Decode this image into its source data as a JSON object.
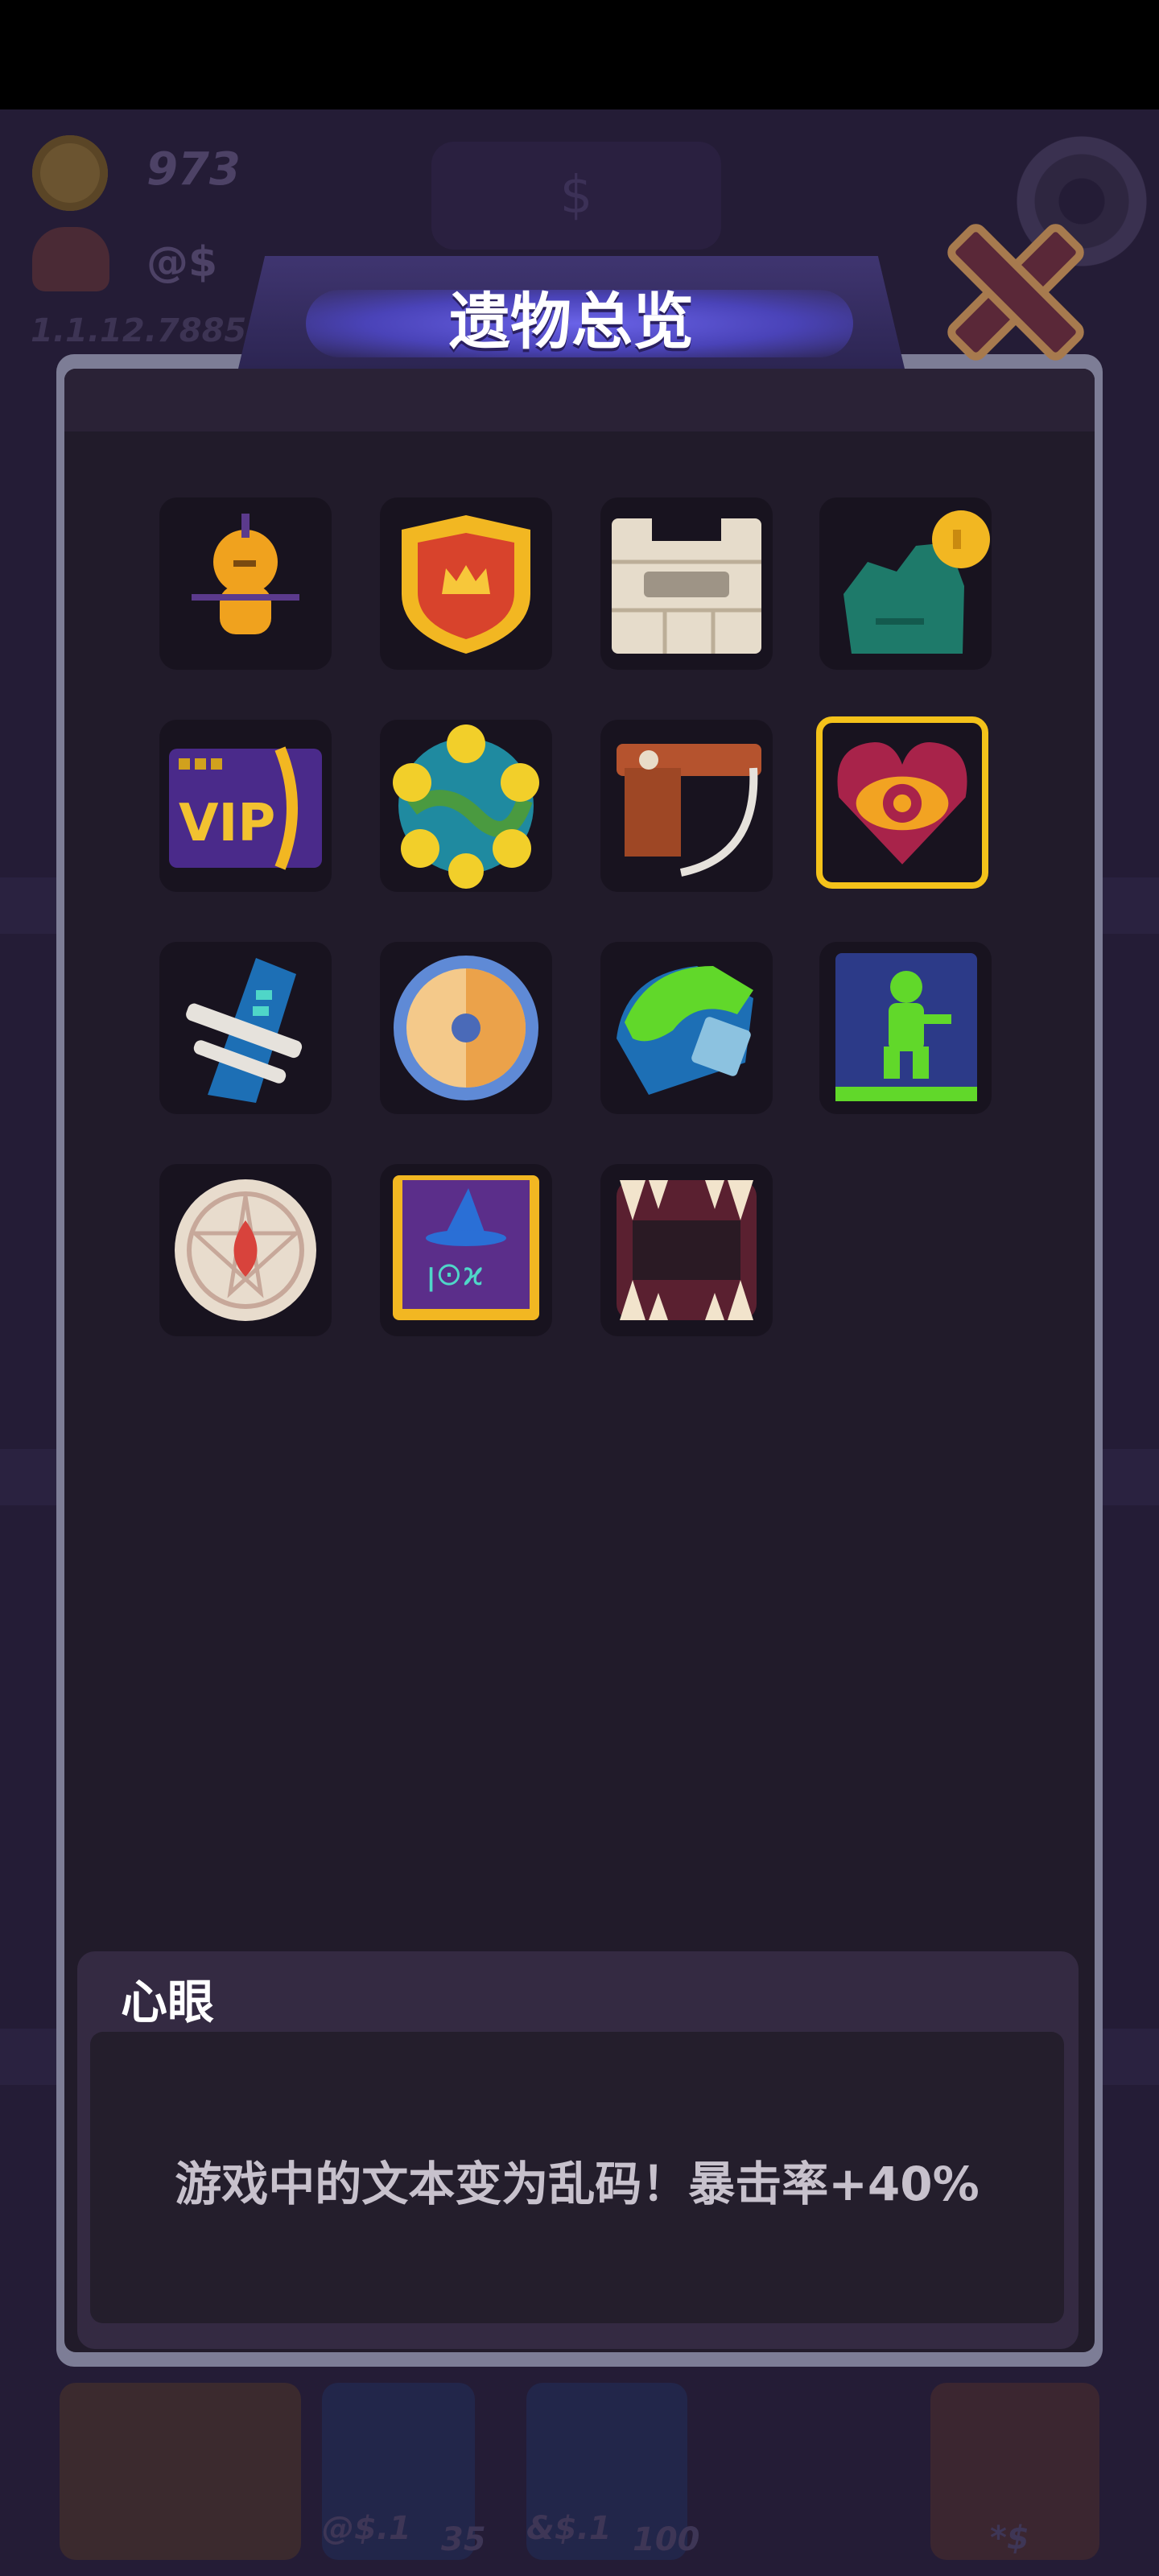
{
  "hud": {
    "coins": "973",
    "store_label": "$",
    "username": "@$",
    "version": "1.1.12.7885-"
  },
  "dialog": {
    "title": "遗物总览",
    "close_icon": "close-x-icon"
  },
  "relics": [
    {
      "icon": "spartan-helmet-figure-icon",
      "selected": false
    },
    {
      "icon": "crown-shield-icon",
      "selected": false
    },
    {
      "icon": "stone-castle-wall-icon",
      "selected": false
    },
    {
      "icon": "zombie-hand-coin-icon",
      "selected": false
    },
    {
      "icon": "vip-card-icon",
      "selected": false
    },
    {
      "icon": "spiked-planet-icon",
      "selected": false
    },
    {
      "icon": "wooden-scythe-icon",
      "selected": false
    },
    {
      "icon": "heart-eye-icon",
      "selected": true
    },
    {
      "icon": "blue-sword-hilt-icon",
      "selected": false
    },
    {
      "icon": "wooden-round-shield-icon",
      "selected": false
    },
    {
      "icon": "slime-fist-icon",
      "selected": false
    },
    {
      "icon": "soldier-book-icon",
      "selected": false
    },
    {
      "icon": "pentagram-drop-icon",
      "selected": false
    },
    {
      "icon": "wizard-spellbook-icon",
      "selected": false
    },
    {
      "icon": "fanged-mouth-icon",
      "selected": false
    }
  ],
  "description": {
    "name": "心眼",
    "text": "游戏中的文本变为乱码！暴击率+40%"
  },
  "bottom_bar": {
    "item1_label": "@$.1",
    "item1_count": "35",
    "item2_label": "&$.1",
    "item2_count": "100",
    "item3_label": "*$"
  },
  "colors": {
    "selected_border": "#f4c21a",
    "panel_bg": "#211b2a",
    "title_glow": "#6a63e8"
  }
}
